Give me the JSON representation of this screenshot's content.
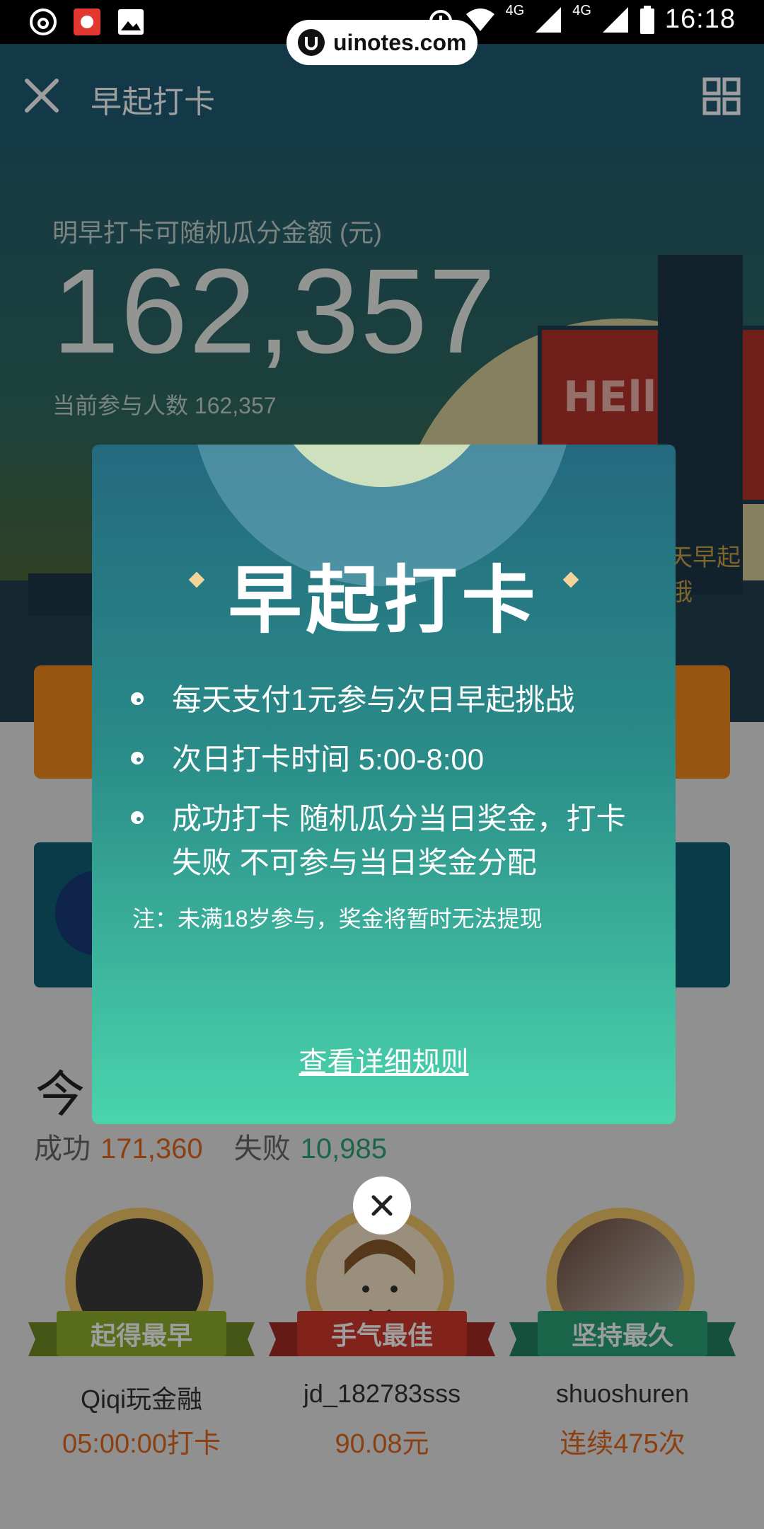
{
  "status_bar": {
    "time": "16:18",
    "network_1": "4G",
    "network_2": "4G",
    "watermark": "uinotes.com"
  },
  "app_bar": {
    "title": "早起打卡",
    "close_icon": "close-icon",
    "menu_icon": "grid-icon"
  },
  "hero": {
    "label": "明早打卡可随机瓜分金额 (元)",
    "amount": "162,357",
    "participants": "当前参与人数 162,357",
    "billboard_text": "HEllo",
    "side_text": "天早起哦"
  },
  "modal": {
    "title": "早起打卡",
    "rules": [
      "每天支付1元参与次日早起挑战",
      "次日打卡时间 5:00-8:00",
      "成功打卡 随机瓜分当日奖金，打卡失败 不可参与当日奖金分配"
    ],
    "note": "注：未满18岁参与，奖金将暂时无法提现",
    "detail_link": "查看详细规则",
    "close_icon": "close-icon"
  },
  "stats": {
    "title_partial": "今",
    "success_label": "成功",
    "success_value": "171,360",
    "fail_label": "失败",
    "fail_value": "10,985"
  },
  "winners": [
    {
      "badge": "起得最早",
      "name": "Qiqi玩金融",
      "stat": "05:00:00打卡",
      "ribbon_color": "#8fae2d"
    },
    {
      "badge": "手气最佳",
      "name": "jd_182783sss",
      "stat": "90.08元",
      "ribbon_color": "#d2392d"
    },
    {
      "badge": "坚持最久",
      "name": "shuoshuren",
      "stat": "连续475次",
      "ribbon_color": "#2aa477"
    }
  ],
  "colors": {
    "app_bar": "#1f5c75",
    "accent_orange": "#e3681c",
    "success_green": "#29a574",
    "modal_top": "#23697e",
    "modal_bottom": "#4ad4ac"
  }
}
